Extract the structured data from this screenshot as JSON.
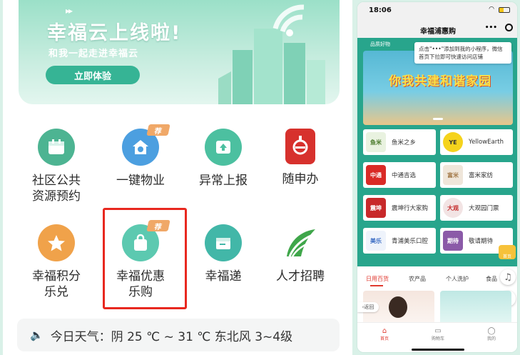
{
  "left": {
    "banner": {
      "title": "幸福云上线啦!",
      "subtitle": "和我一起走进幸福云",
      "button": "立即体验"
    },
    "grid": [
      {
        "label": "社区公共资源预约",
        "icon": "calendar-icon",
        "color": "#4db492"
      },
      {
        "label": "一键物业",
        "icon": "home-service-icon",
        "color": "#4c9fe0",
        "tag": "荐"
      },
      {
        "label": "异常上报",
        "icon": "upload-icon",
        "color": "#4cc0a0"
      },
      {
        "label": "随申办",
        "icon": "suishenban-logo-icon",
        "color": "#d7312d"
      },
      {
        "label": "幸福积分乐兑",
        "icon": "star-icon",
        "color": "#f0a24a"
      },
      {
        "label": "幸福优惠乐购",
        "icon": "shopping-bag-icon",
        "color": "#5cc9b0",
        "tag": "荐"
      },
      {
        "label": "幸福递",
        "icon": "package-icon",
        "color": "#42b7a8"
      },
      {
        "label": "人才招聘",
        "icon": "leaf-logo-icon",
        "color": "#3fa64a"
      }
    ],
    "weather": "今日天气：阴 25 ℃ ~ 31 ℃ 东北风 3~4级"
  },
  "right": {
    "status_time": "18:06",
    "nav_title": "幸福浦惠购",
    "nav_more": "•••",
    "nav_sub_left": "品质好物",
    "tip": "点击\"•••\"添加到我的小程序，微信首页下拉即可快速访问店铺",
    "banner_text": "你我共建和谐家园",
    "brands": [
      {
        "name": "鱼米之乡",
        "color": "#e9f2e0",
        "logo_text": "鱼米"
      },
      {
        "name": "YellowEarth",
        "color": "#f5d31d",
        "logo_text": "YE"
      },
      {
        "name": "中通吉选",
        "color": "#d92a26",
        "logo_text": "中通"
      },
      {
        "name": "富米家纺",
        "color": "#efe6da",
        "logo_text": "富米"
      },
      {
        "name": "震坤行大家购",
        "color": "#c8292a",
        "logo_text": "震坤"
      },
      {
        "name": "大观园门票",
        "color": "#f2e4e4",
        "logo_text": "大观"
      },
      {
        "name": "青浦美乐口腔",
        "color": "#eef3fb",
        "logo_text": "美乐"
      },
      {
        "name": "敬请期待",
        "color": "#8b5aa8",
        "logo_text": "期待"
      }
    ],
    "tabs": [
      "日用百货",
      "农产品",
      "个人洗护",
      "食品"
    ],
    "back": "返回",
    "bottom": [
      "首页",
      "购物车",
      "我的"
    ],
    "badge": "首页"
  }
}
